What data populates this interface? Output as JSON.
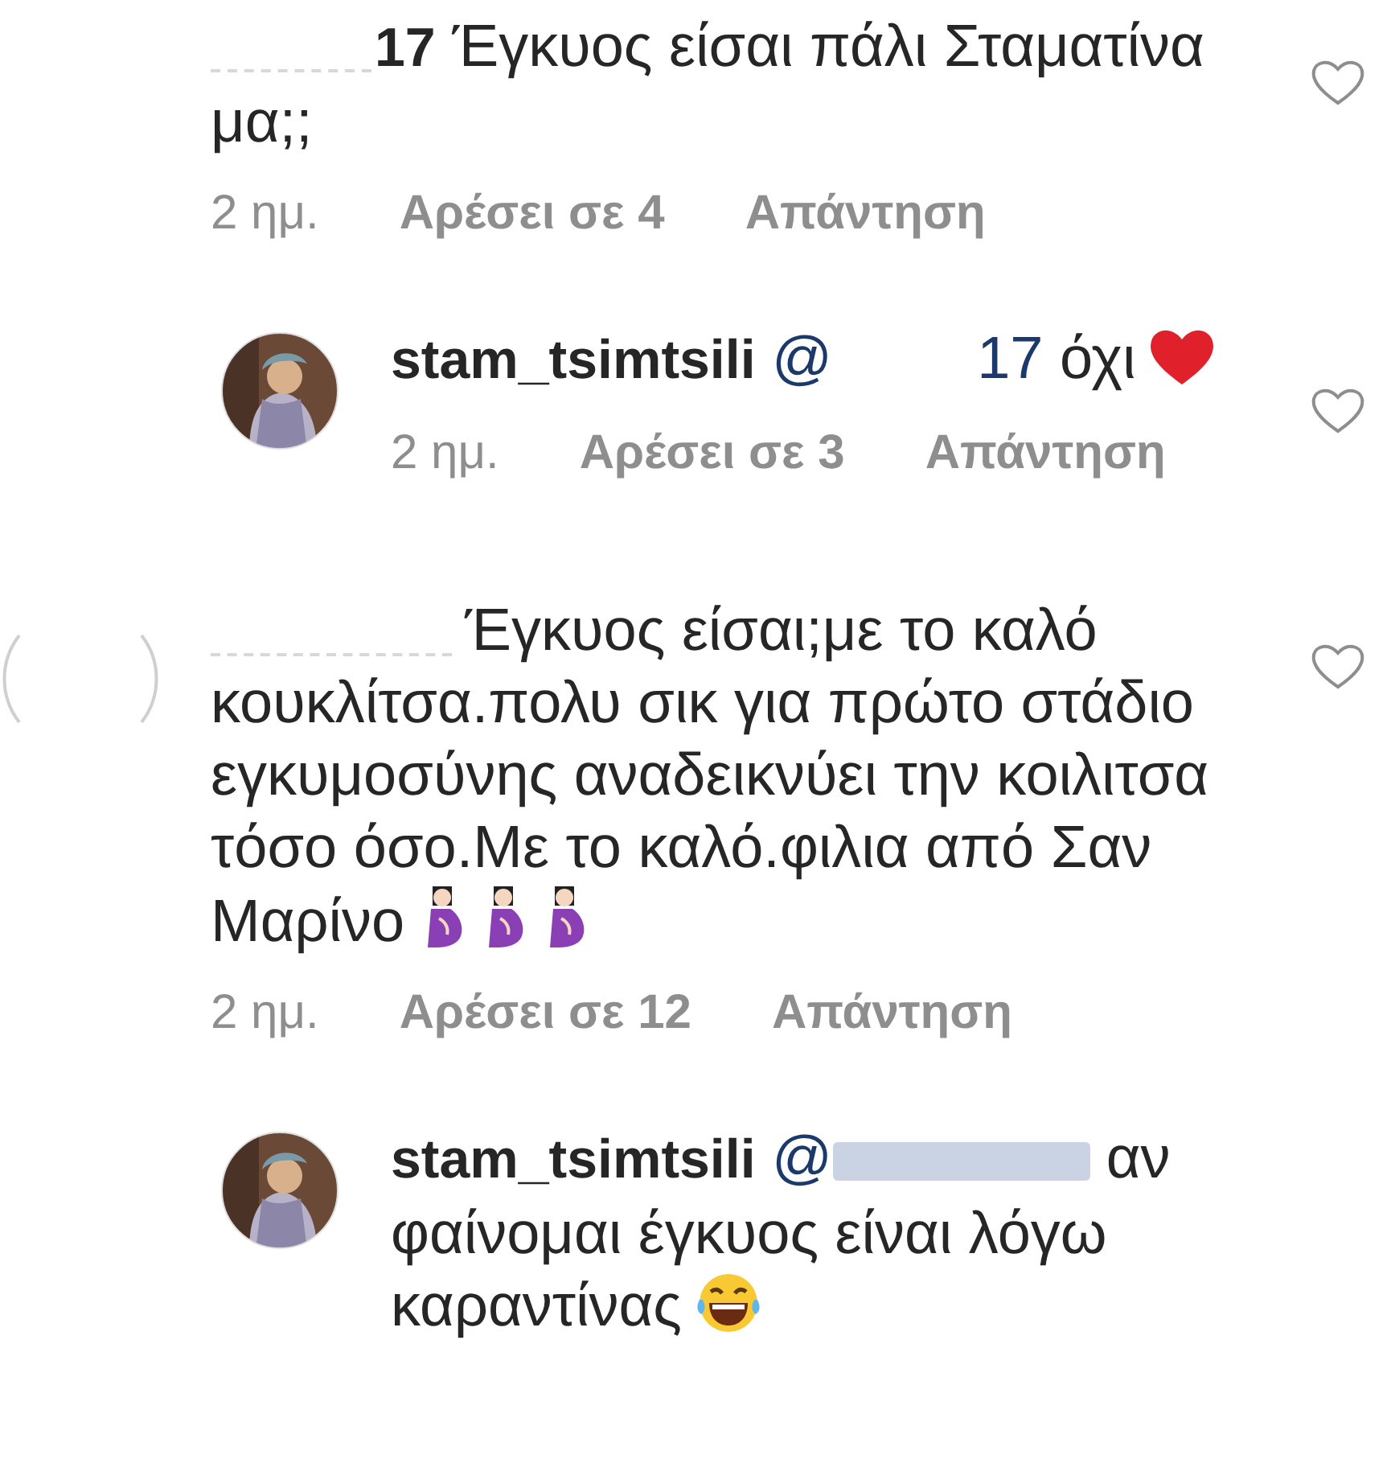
{
  "comments": [
    {
      "kind": "comment",
      "username_redacted": true,
      "username": "17",
      "text": "Έγκυος είσαι πάλι Σταματίνα μα;;",
      "time": "2 ημ.",
      "likes": "Αρέσει σε 4",
      "reply": "Απάντηση",
      "liked": false
    },
    {
      "kind": "reply",
      "username": "stam_tsimtsili",
      "mention": "@",
      "mention_tail": "17",
      "text": "όχι",
      "icons": [
        {
          "kind": "heart"
        }
      ],
      "time": "2 ημ.",
      "likes": "Αρέσει σε 3",
      "reply": "Απάντηση",
      "liked": false
    },
    {
      "kind": "comment",
      "avatar": {
        "kind": "outline"
      },
      "username_redacted": true,
      "text": "Έγκυος είσαι;με το καλό κουκλίτσα.πολυ σικ για πρώτο στάδιο εγκυμοσύνης αναδεικνύει την κοιλιτσα τόσο όσο.Με το καλό.φιλια από Σαν Μαρίνο",
      "icons": [
        {
          "kind": "pregnant"
        },
        {
          "kind": "pregnant"
        },
        {
          "kind": "pregnant"
        }
      ],
      "time": "2 ημ.",
      "likes": "Αρέσει σε 12",
      "reply": "Απάντηση",
      "liked": false
    },
    {
      "kind": "reply",
      "username": "stam_tsimtsili",
      "mention": "@",
      "mention_redacted": true,
      "text": "αν φαίνομαι έγκυος είναι λόγω καραντίνας",
      "icons": [
        {
          "kind": "laughing"
        }
      ]
    }
  ]
}
